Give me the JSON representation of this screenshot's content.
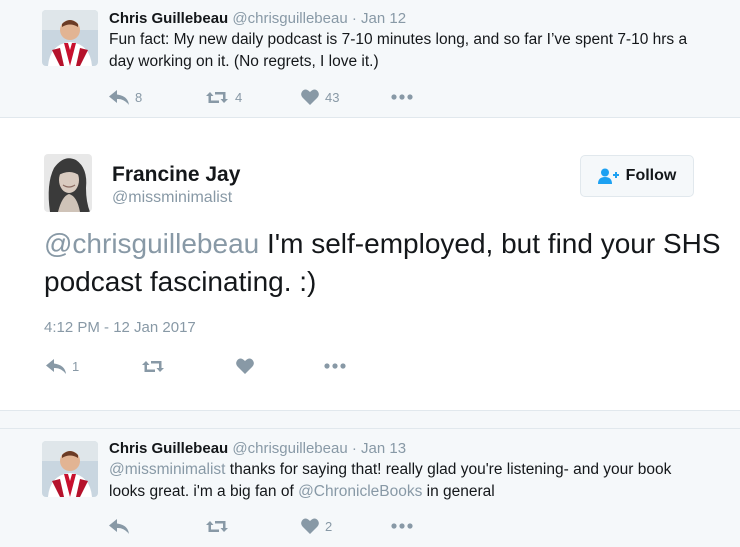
{
  "tweet1": {
    "name": "Chris Guillebeau",
    "handle": "@chrisguillebeau",
    "dot": "·",
    "date": "Jan 12",
    "text": "Fun fact: My new daily podcast is 7-10 minutes long, and so far I’ve spent 7-10 hrs a day working on it. (No regrets, I love it.)",
    "replies": "8",
    "retweets": "4",
    "likes": "43"
  },
  "main": {
    "name": "Francine Jay",
    "handle": "@missminimalist",
    "follow_label": "Follow",
    "mention": "@chrisguillebeau",
    "text": " I'm self-employed, but find your SHS podcast fascinating. :)",
    "timestamp": "4:12 PM - 12 Jan 2017",
    "replies": "1"
  },
  "tweet3": {
    "name": "Chris Guillebeau",
    "handle": "@chrisguillebeau",
    "dot": "·",
    "date": "Jan 13",
    "mention1": "@missminimalist",
    "text1": " thanks for saying that! really glad you're listening- and your book looks great. i'm a big fan of ",
    "mention2": "@ChronicleBooks",
    "text2": " in general",
    "likes": "2"
  },
  "colors": {
    "muted": "#8899a6",
    "text": "#14171a",
    "background_alt": "#f5f8fa",
    "border": "#e1e8ed",
    "follow_icon": "#1da1f2"
  },
  "icons": [
    "reply-icon",
    "retweet-icon",
    "heart-icon",
    "more-icon",
    "add-user-icon"
  ]
}
